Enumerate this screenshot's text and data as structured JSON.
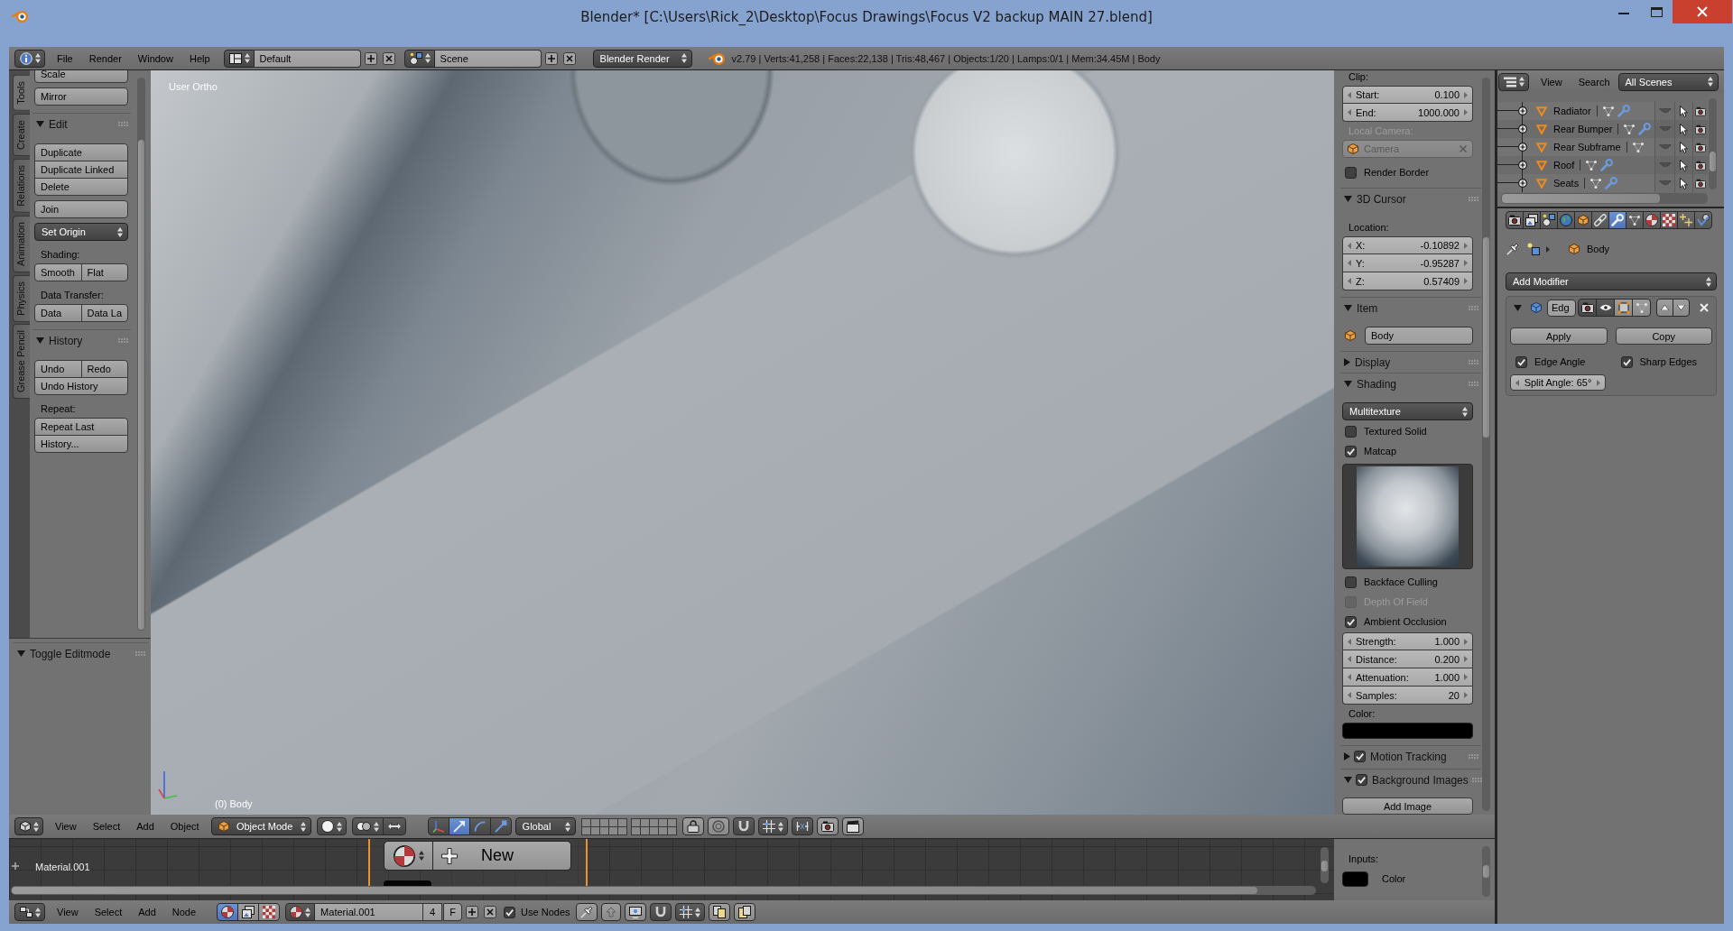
{
  "window": {
    "title": "Blender* [C:\\Users\\Rick_2\\Desktop\\Focus Drawings\\Focus V2 backup MAIN 27.blend]"
  },
  "info_header": {
    "menus": [
      "File",
      "Render",
      "Window",
      "Help"
    ],
    "layout": "Default",
    "scene": "Scene",
    "engine": "Blender Render",
    "stats": "v2.79 | Verts:41,258 | Faces:22,138 | Tris:48,467 | Objects:1/20 | Lamps:0/1 | Mem:34.45M | Body"
  },
  "tool_shelf": {
    "tabs": [
      {
        "label": "Tools",
        "selected": true
      },
      {
        "label": "Create",
        "selected": false
      },
      {
        "label": "Relations",
        "selected": false
      },
      {
        "label": "Animation",
        "selected": false
      },
      {
        "label": "Physics",
        "selected": false
      },
      {
        "label": "Grease Pencil",
        "selected": false
      }
    ],
    "items": [
      {
        "kind": "buttons",
        "rows": [
          [
            "Scale"
          ]
        ]
      },
      {
        "kind": "buttons",
        "rows": [
          [
            "Mirror"
          ]
        ]
      },
      {
        "kind": "section",
        "label": "Edit",
        "expanded": true
      },
      {
        "kind": "buttons",
        "rows": [
          [
            "Duplicate"
          ],
          [
            "Duplicate Linked"
          ],
          [
            "Delete"
          ]
        ]
      },
      {
        "kind": "buttons",
        "rows": [
          [
            "Join"
          ]
        ]
      },
      {
        "kind": "dropdown",
        "label": "Set Origin"
      },
      {
        "kind": "label",
        "label": "Shading:"
      },
      {
        "kind": "buttons",
        "rows": [
          [
            "Smooth",
            "Flat"
          ]
        ]
      },
      {
        "kind": "label",
        "label": "Data Transfer:"
      },
      {
        "kind": "buttons",
        "rows": [
          [
            "Data",
            "Data La"
          ]
        ]
      },
      {
        "kind": "section",
        "label": "History",
        "expanded": true
      },
      {
        "kind": "buttons",
        "rows": [
          [
            "Undo",
            "Redo"
          ],
          [
            "Undo History"
          ]
        ]
      },
      {
        "kind": "label",
        "label": "Repeat:"
      },
      {
        "kind": "buttons",
        "rows": [
          [
            "Repeat Last"
          ],
          [
            "History..."
          ]
        ]
      }
    ],
    "operator_panel": {
      "label": "Toggle Editmode",
      "expanded": true
    }
  },
  "viewport": {
    "view_name": "User Ortho",
    "object_label": "(0) Body"
  },
  "view_properties": {
    "items": [
      {
        "kind": "label",
        "label": "Clip:",
        "disabled": false
      },
      {
        "kind": "numbers",
        "fields": [
          {
            "label": "Start:",
            "value": "0.100"
          },
          {
            "label": "End:",
            "value": "1000.000"
          }
        ]
      },
      {
        "kind": "label",
        "label": "Local Camera:",
        "disabled": true
      },
      {
        "kind": "object_field",
        "value": "Camera",
        "disabled": true
      },
      {
        "kind": "checkbox",
        "label": "Render Border",
        "checked": false,
        "disabled": false
      },
      {
        "kind": "section",
        "label": "3D Cursor",
        "expanded": true
      },
      {
        "kind": "label",
        "label": "Location:",
        "disabled": false
      },
      {
        "kind": "numbers",
        "fields": [
          {
            "label": "X:",
            "value": "-0.10892"
          },
          {
            "label": "Y:",
            "value": "-0.95287"
          },
          {
            "label": "Z:",
            "value": "0.57409"
          }
        ]
      },
      {
        "kind": "section",
        "label": "Item",
        "expanded": true
      },
      {
        "kind": "name_field",
        "value": "Body"
      },
      {
        "kind": "section",
        "label": "Display",
        "expanded": false
      },
      {
        "kind": "section",
        "label": "Shading",
        "expanded": true
      },
      {
        "kind": "dropdown",
        "label": "Multitexture"
      },
      {
        "kind": "checkbox",
        "label": "Textured Solid",
        "checked": false,
        "disabled": false
      },
      {
        "kind": "checkbox",
        "label": "Matcap",
        "checked": true,
        "disabled": false
      },
      {
        "kind": "matcap"
      },
      {
        "kind": "checkbox",
        "label": "Backface Culling",
        "checked": false,
        "disabled": false
      },
      {
        "kind": "checkbox",
        "label": "Depth Of Field",
        "checked": false,
        "disabled": true
      },
      {
        "kind": "checkbox",
        "label": "Ambient Occlusion",
        "checked": true,
        "disabled": false
      },
      {
        "kind": "numbers",
        "fields": [
          {
            "label": "Strength:",
            "value": "1.000"
          },
          {
            "label": "Distance:",
            "value": "0.200"
          },
          {
            "label": "Attenuation:",
            "value": "1.000"
          },
          {
            "label": "Samples:",
            "value": "20"
          }
        ]
      },
      {
        "kind": "label",
        "label": "Color:",
        "disabled": false
      },
      {
        "kind": "color",
        "color": "#000000"
      },
      {
        "kind": "section_toggle",
        "label": "Motion Tracking",
        "expanded": false,
        "checked": true
      },
      {
        "kind": "section_toggle",
        "label": "Background Images",
        "expanded": true,
        "checked": true
      },
      {
        "kind": "button",
        "label": "Add Image"
      }
    ]
  },
  "viewport_header": {
    "menus": [
      "View",
      "Select",
      "Add",
      "Object"
    ],
    "mode": "Object Mode",
    "manipulators": [
      {
        "kind": "translate",
        "selected": true
      },
      {
        "kind": "rotate",
        "selected": false
      },
      {
        "kind": "scale",
        "selected": false
      }
    ],
    "orientation": "Global"
  },
  "node_editor": {
    "tree_name": "Material.001",
    "new_button": "New",
    "sidebar": {
      "heading": "Inputs:",
      "inputs": [
        {
          "label": "Color",
          "color": "#000000"
        }
      ]
    }
  },
  "node_header": {
    "menus": [
      "View",
      "Select",
      "Add",
      "Node"
    ],
    "shader_types": [
      {
        "kind": "object",
        "selected": true
      },
      {
        "kind": "world",
        "selected": false
      },
      {
        "kind": "linestyle",
        "selected": false
      }
    ],
    "material": "Material.001",
    "users": "4",
    "fake_user": "F",
    "use_nodes": {
      "label": "Use Nodes",
      "checked": true
    }
  },
  "outliner": {
    "menus": [
      "View",
      "Search"
    ],
    "filter": "All Scenes",
    "rows": [
      {
        "name": "Radiator",
        "modifier": true,
        "selected": false
      },
      {
        "name": "Rear Bumper",
        "modifier": true,
        "selected": false
      },
      {
        "name": "Rear Subframe",
        "modifier": false,
        "selected": false
      },
      {
        "name": "Roof",
        "modifier": true,
        "selected": false
      },
      {
        "name": "Seats",
        "modifier": true,
        "selected": false
      }
    ]
  },
  "properties": {
    "tabs": [
      {
        "kind": "render",
        "selected": false
      },
      {
        "kind": "render_layers",
        "selected": false
      },
      {
        "kind": "scene",
        "selected": false
      },
      {
        "kind": "world",
        "selected": false
      },
      {
        "kind": "object",
        "selected": false
      },
      {
        "kind": "constraints",
        "selected": false
      },
      {
        "kind": "modifiers",
        "selected": true
      },
      {
        "kind": "data",
        "selected": false
      },
      {
        "kind": "material",
        "selected": false
      },
      {
        "kind": "texture",
        "selected": false
      },
      {
        "kind": "particles",
        "selected": false
      },
      {
        "kind": "physics",
        "selected": false
      }
    ],
    "context": "Body",
    "add_modifier": "Add Modifier",
    "modifier": {
      "name": "Edg",
      "expanded": true,
      "actions": [
        "Apply",
        "Copy"
      ],
      "options": [
        {
          "label": "Edge Angle",
          "checked": true
        },
        {
          "label": "Sharp Edges",
          "checked": true
        }
      ],
      "split_angle": "Split Angle: 65°"
    }
  }
}
